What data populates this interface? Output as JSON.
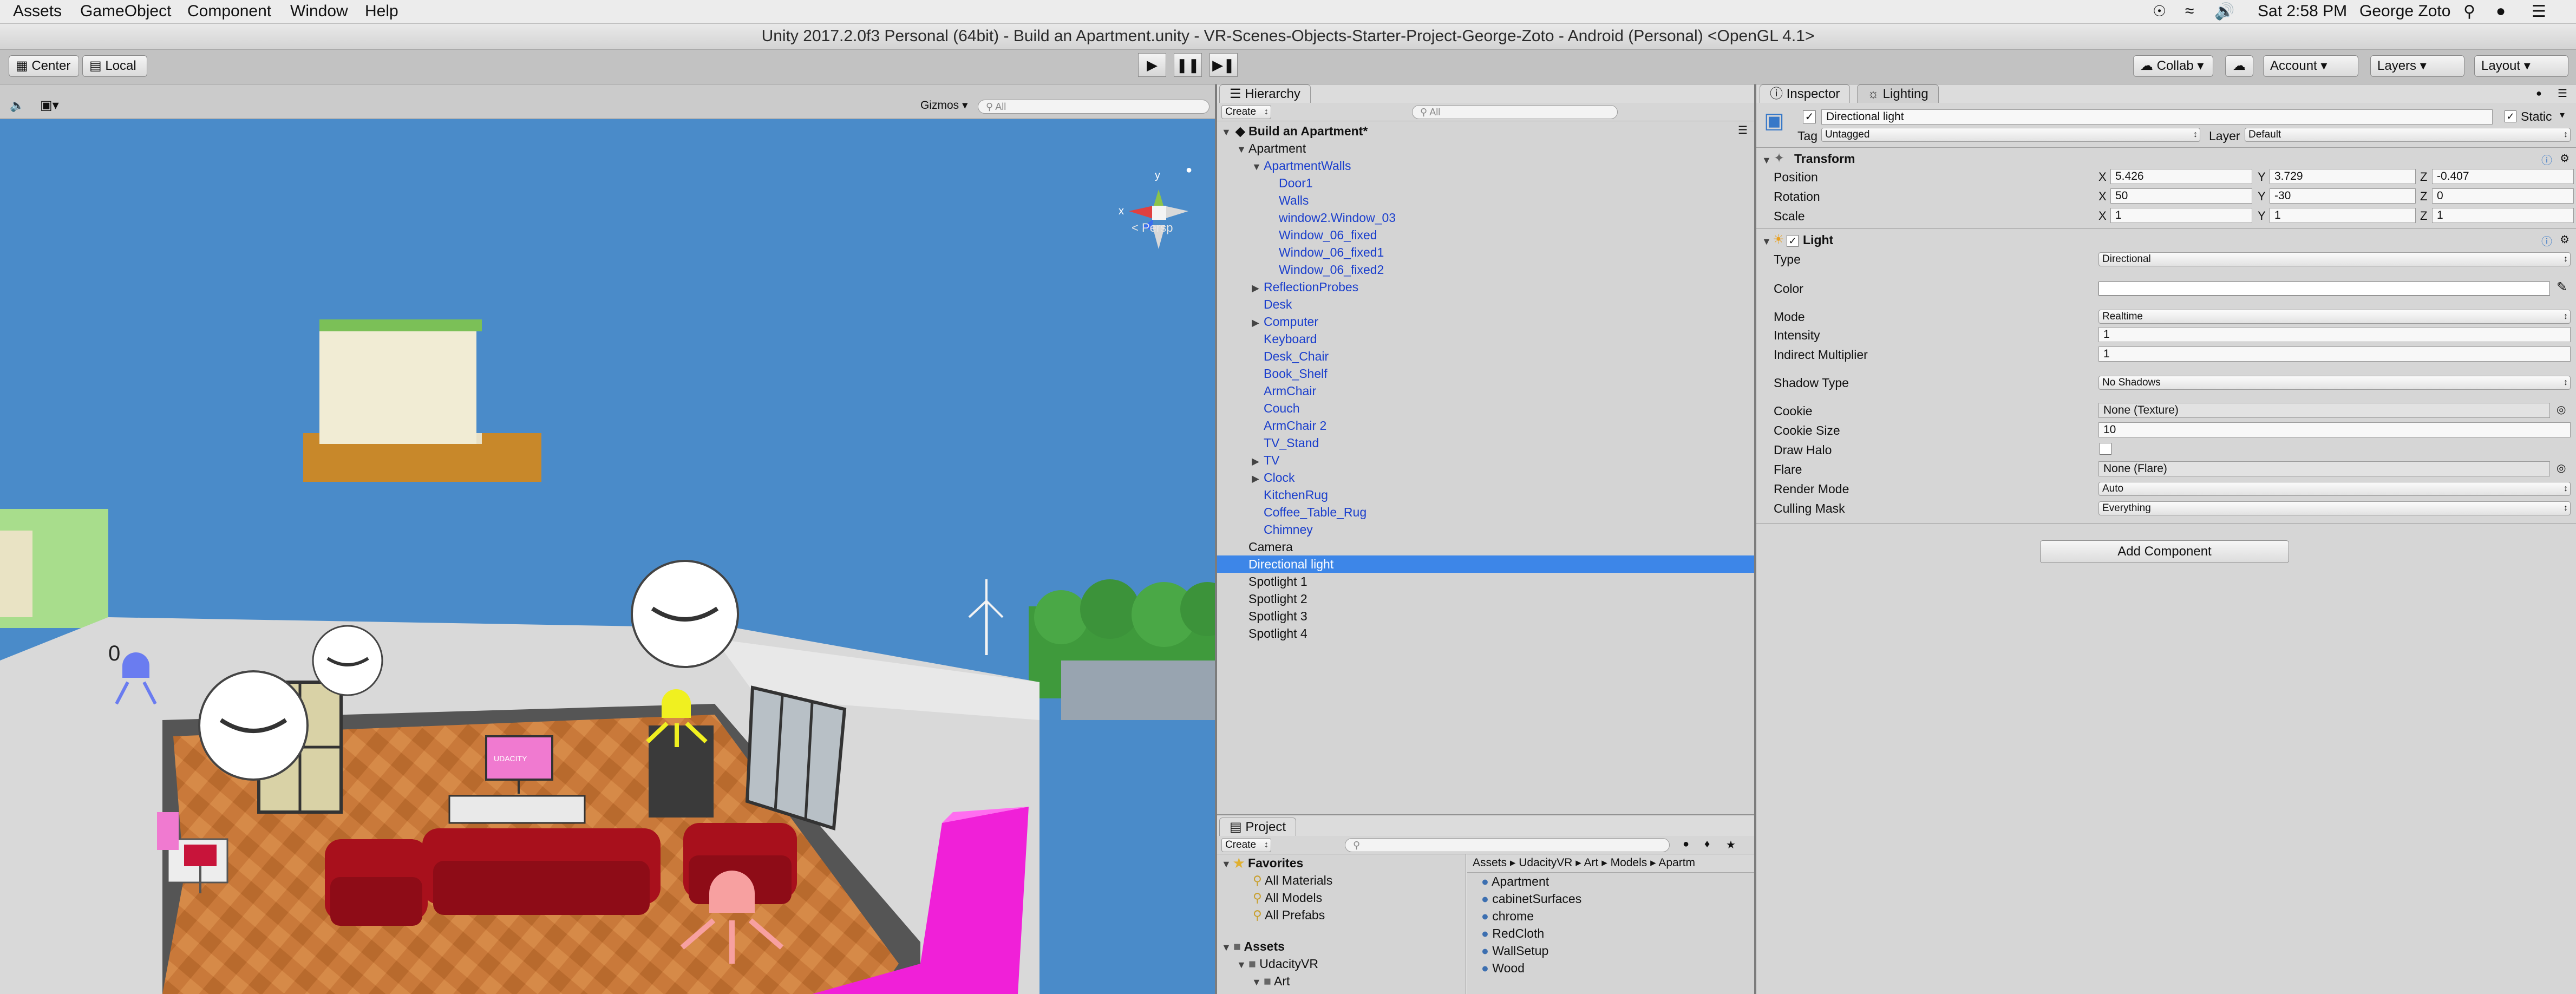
{
  "menubar": {
    "items": [
      "Assets",
      "GameObject",
      "Component",
      "Window",
      "Help"
    ],
    "clock": "Sat 2:58 PM",
    "user": "George Zoto"
  },
  "window": {
    "title": "Unity 2017.2.0f3 Personal (64bit) - Build an Apartment.unity - VR-Scenes-Objects-Starter-Project-George-Zoto - Android (Personal) <OpenGL 4.1>"
  },
  "toolbar": {
    "pivot": "Center",
    "space": "Local",
    "collab": "Collab",
    "account": "Account",
    "layers": "Layers",
    "layout": "Layout"
  },
  "scene": {
    "gizmos": "Gizmos",
    "search_placeholder": "All",
    "persp": "Persp",
    "axis_y": "y",
    "axis_x": "x",
    "sky_color": "#4a8bc9",
    "floor_color": "#c47a34",
    "couch_color": "#a8101c",
    "tv_screen_text": "UDACITY"
  },
  "hierarchy": {
    "tab": "Hierarchy",
    "create": "Create",
    "search_placeholder": "All",
    "scene_name": "Build an Apartment*",
    "items": [
      {
        "label": "Apartment",
        "prefab": false
      },
      {
        "label": "ApartmentWalls",
        "prefab": true
      },
      {
        "label": "Door1",
        "prefab": true
      },
      {
        "label": "Walls",
        "prefab": true
      },
      {
        "label": "window2.Window_03",
        "prefab": true
      },
      {
        "label": "Window_06_fixed",
        "prefab": true
      },
      {
        "label": "Window_06_fixed1",
        "prefab": true
      },
      {
        "label": "Window_06_fixed2",
        "prefab": true
      },
      {
        "label": "ReflectionProbes",
        "prefab": true
      },
      {
        "label": "Desk",
        "prefab": true
      },
      {
        "label": "Computer",
        "prefab": true
      },
      {
        "label": "Keyboard",
        "prefab": true
      },
      {
        "label": "Desk_Chair",
        "prefab": true
      },
      {
        "label": "Book_Shelf",
        "prefab": true
      },
      {
        "label": "ArmChair",
        "prefab": true
      },
      {
        "label": "Couch",
        "prefab": true
      },
      {
        "label": "ArmChair 2",
        "prefab": true
      },
      {
        "label": "TV_Stand",
        "prefab": true
      },
      {
        "label": "TV",
        "prefab": true
      },
      {
        "label": "Clock",
        "prefab": true
      },
      {
        "label": "KitchenRug",
        "prefab": true
      },
      {
        "label": "Coffee_Table_Rug",
        "prefab": true
      },
      {
        "label": "Chimney",
        "prefab": true
      },
      {
        "label": "Camera",
        "prefab": false
      },
      {
        "label": "Directional light",
        "prefab": false
      },
      {
        "label": "Spotlight 1",
        "prefab": false
      },
      {
        "label": "Spotlight 2",
        "prefab": false
      },
      {
        "label": "Spotlight 3",
        "prefab": false
      },
      {
        "label": "Spotlight 4",
        "prefab": false
      }
    ]
  },
  "project": {
    "tab": "Project",
    "create": "Create",
    "favorites": "Favorites",
    "fav_items": [
      "All Materials",
      "All Models",
      "All Prefabs"
    ],
    "assets": "Assets",
    "udacityvr": "UdacityVR",
    "art": "Art",
    "breadcrumb": [
      "Assets",
      "UdacityVR",
      "Art",
      "Models",
      "Apartm"
    ],
    "files": [
      "Apartment",
      "cabinetSurfaces",
      "chrome",
      "RedCloth",
      "WallSetup",
      "Wood"
    ]
  },
  "inspector": {
    "tab": "Inspector",
    "tab2": "Lighting",
    "object_name": "Directional light",
    "static": "Static",
    "tag_label": "Tag",
    "tag_value": "Untagged",
    "layer_label": "Layer",
    "layer_value": "Default",
    "transform": {
      "title": "Transform",
      "position_label": "Position",
      "rotation_label": "Rotation",
      "scale_label": "Scale",
      "position": [
        "5.426",
        "3.729",
        "-0.407"
      ],
      "rotation": [
        "50",
        "-30",
        "0"
      ],
      "scale": [
        "1",
        "1",
        "1"
      ]
    },
    "light": {
      "title": "Light",
      "type_label": "Type",
      "type_value": "Directional",
      "color_label": "Color",
      "mode_label": "Mode",
      "mode_value": "Realtime",
      "intensity_label": "Intensity",
      "intensity_value": "1",
      "indirect_label": "Indirect Multiplier",
      "indirect_value": "1",
      "shadow_label": "Shadow Type",
      "shadow_value": "No Shadows",
      "cookie_label": "Cookie",
      "cookie_value": "None (Texture)",
      "cookie_size_label": "Cookie Size",
      "cookie_size_value": "10",
      "halo_label": "Draw Halo",
      "flare_label": "Flare",
      "flare_value": "None (Flare)",
      "render_label": "Render Mode",
      "render_value": "Auto",
      "culling_label": "Culling Mask",
      "culling_value": "Everything"
    },
    "add_component": "Add Component"
  }
}
